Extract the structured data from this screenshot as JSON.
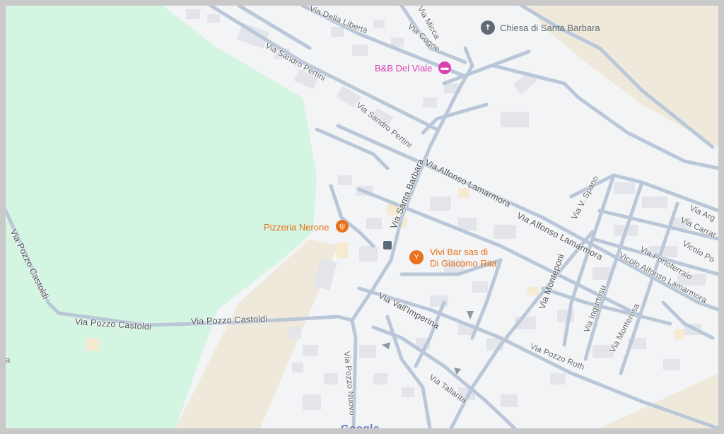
{
  "map": {
    "colors": {
      "background": "#f3f4f6",
      "park": "#d4f5e2",
      "sand": "#efe9db",
      "road": "#b9c7d8",
      "building": "#e3e5ea",
      "building_tan": "#f6ead0",
      "worship": "#5f6b74",
      "lodging": "#dd3fb3",
      "food": "#e8711a"
    },
    "pois": [
      {
        "name": "Chiesa di Santa Barbara",
        "icon": "cross-icon",
        "category": "worship"
      },
      {
        "name": "B&B Del Viale",
        "icon": "bed-icon",
        "category": "lodging"
      },
      {
        "name": "Pizzeria Nerone",
        "icon": "fork-knife-icon",
        "category": "food"
      },
      {
        "name": "Vivi Bar sas di",
        "name_line2": "Di Giacomo Rita",
        "icon": "cocktail-icon",
        "category": "food"
      }
    ],
    "streets": [
      "Via Della Libertà",
      "Via Cogne",
      "Via Micca",
      "Via Sandro Pertini",
      "Via Sandro Pertini",
      "Via Santa Barbara",
      "Via Alfonso Lamarmora",
      "Via Alfonso Lamarmora",
      "Via V. Spano",
      "Via Arg",
      "Via Carrar",
      "Vicolo Po",
      "Via Portoferraio",
      "Vicolo Alfonso Lamarmora",
      "Via Monteponi",
      "Via Ingurtosu",
      "Via Monterosa",
      "Via Vall'Imperina",
      "Via Pozzo Roth",
      "Via Tallarita",
      "Via Pozzo Nuovo",
      "Via Pozzo Castoldi",
      "Via Pozzo Castoldi",
      "Via Pozzo Castoldi"
    ],
    "edge_fragment": "a",
    "bus_stop_icon": "bus-stop-icon",
    "logo": "Google"
  }
}
